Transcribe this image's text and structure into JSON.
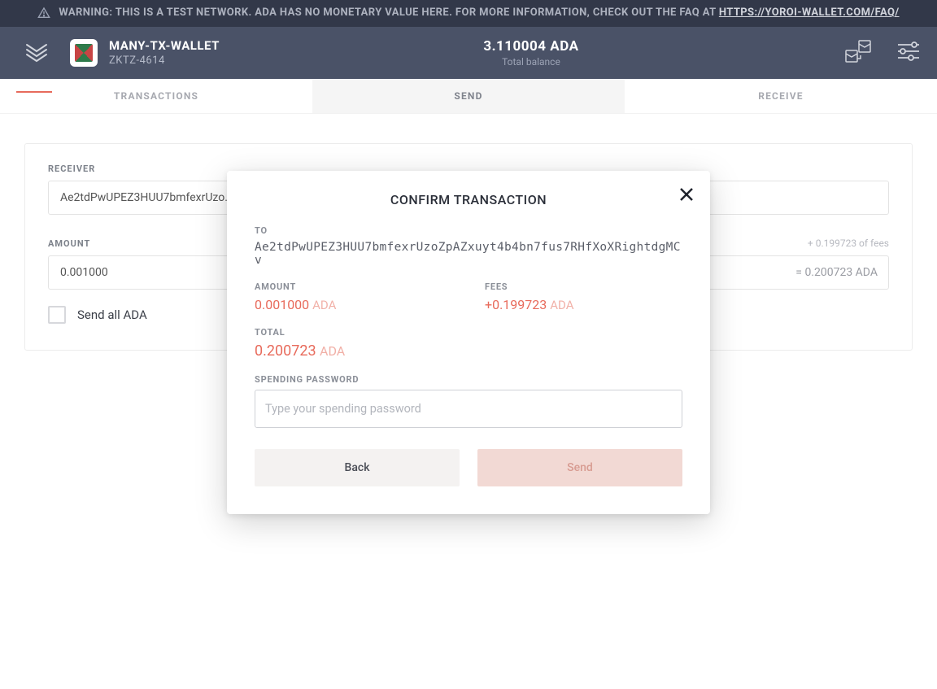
{
  "warning": {
    "text": "WARNING: THIS IS A TEST NETWORK. ADA HAS NO MONETARY VALUE HERE. FOR MORE INFORMATION, CHECK OUT THE FAQ AT ",
    "link_text": "HTTPS://YOROI-WALLET.COM/FAQ/"
  },
  "header": {
    "wallet_name": "MANY-TX-WALLET",
    "wallet_plate": "ZKTZ-4614",
    "balance_value": "3.110004 ADA",
    "balance_label": "Total balance"
  },
  "tabs": {
    "transactions": "TRANSACTIONS",
    "send": "SEND",
    "receive": "RECEIVE"
  },
  "form": {
    "receiver_label": "RECEIVER",
    "receiver_value": "Ae2tdPwUPEZ3HUU7bmfexrUzo.",
    "amount_label": "AMOUNT",
    "amount_value": "0.001000",
    "fee_hint": "+ 0.199723 of fees",
    "amount_equiv": "= 0.200723 ADA",
    "send_all_label": "Send all ADA"
  },
  "modal": {
    "title": "CONFIRM TRANSACTION",
    "to_label": "TO",
    "to_address": "Ae2tdPwUPEZ3HUU7bmfexrUzoZpAZxuyt4b4bn7fus7RHfXoXRightdgMCv",
    "amount_label": "AMOUNT",
    "amount_value": "0.001000",
    "amount_currency": "ADA",
    "fees_label": "FEES",
    "fees_value": "+0.199723",
    "fees_currency": "ADA",
    "total_label": "TOTAL",
    "total_value": "0.200723",
    "total_currency": "ADA",
    "password_label": "SPENDING PASSWORD",
    "password_placeholder": "Type your spending password",
    "back_label": "Back",
    "send_label": "Send"
  }
}
